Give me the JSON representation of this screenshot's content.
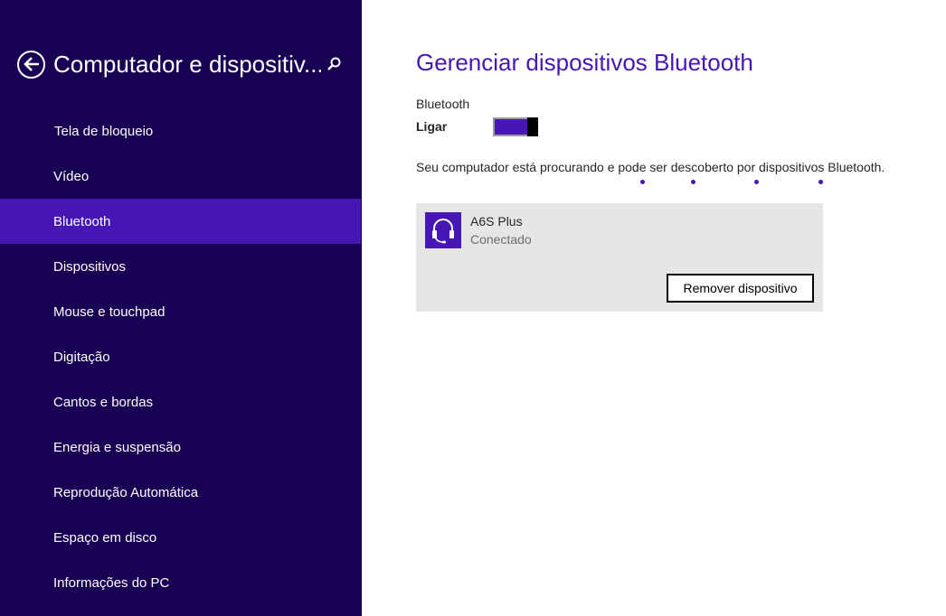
{
  "sidebar": {
    "title": "Computador e dispositiv...",
    "back_icon": "back-arrow-icon",
    "search_icon": "search-icon",
    "items": [
      {
        "label": "Tela de bloqueio",
        "selected": false
      },
      {
        "label": "Vídeo",
        "selected": false
      },
      {
        "label": "Bluetooth",
        "selected": true
      },
      {
        "label": "Dispositivos",
        "selected": false
      },
      {
        "label": "Mouse e touchpad",
        "selected": false
      },
      {
        "label": "Digitação",
        "selected": false
      },
      {
        "label": "Cantos e bordas",
        "selected": false
      },
      {
        "label": "Energia e suspensão",
        "selected": false
      },
      {
        "label": "Reprodução Automática",
        "selected": false
      },
      {
        "label": "Espaço em disco",
        "selected": false
      },
      {
        "label": "Informações do PC",
        "selected": false
      }
    ]
  },
  "main": {
    "title": "Gerenciar dispositivos Bluetooth",
    "bluetooth_label": "Bluetooth",
    "toggle_state": "Ligar",
    "toggle_on": true,
    "status_text": "Seu computador está procurando e pode ser descoberto por dispositivos Bluetooth.",
    "device": {
      "name": "A6S Plus",
      "status": "Conectado",
      "icon": "headset-icon",
      "remove_label": "Remover dispositivo"
    }
  },
  "colors": {
    "sidebar_bg": "#180052",
    "accent": "#4617b4",
    "card_bg": "#e6e6e6"
  }
}
